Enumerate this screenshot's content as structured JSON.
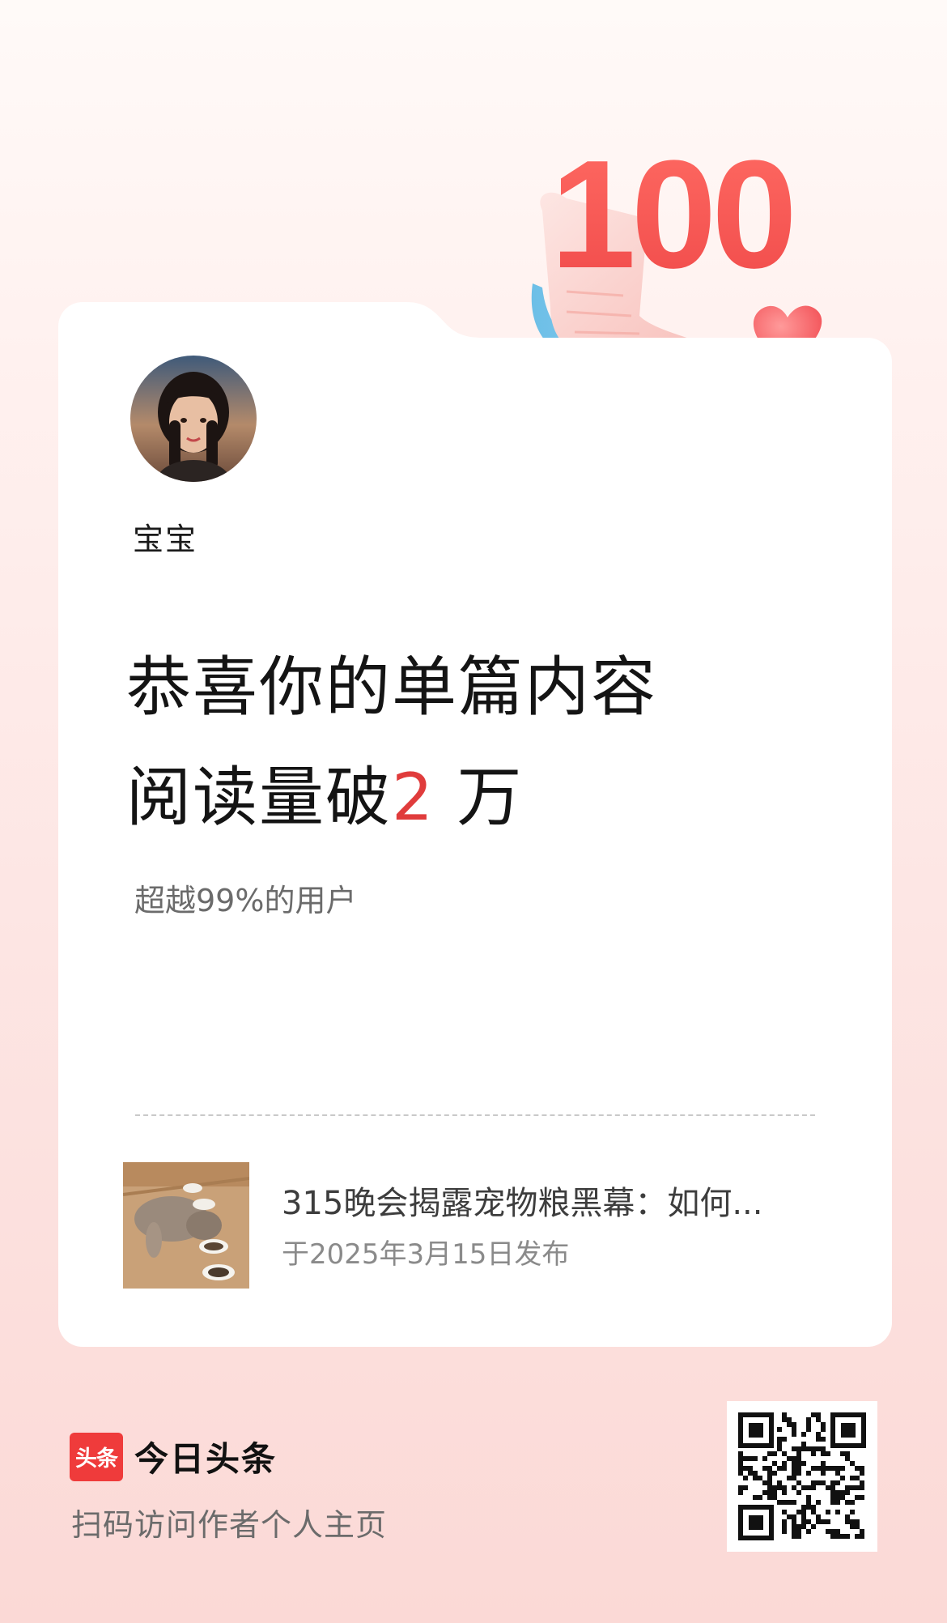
{
  "badge": {
    "number": "100"
  },
  "user": {
    "name": "宝宝"
  },
  "headline": {
    "line1": "恭喜你的单篇内容",
    "line2_prefix": "阅读量破",
    "line2_number": "2",
    "line2_suffix": " 万"
  },
  "subline": "超越99%的用户",
  "article": {
    "title": "315晚会揭露宠物粮黑幕：如何...",
    "date": "于2025年3月15日发布"
  },
  "footer": {
    "logo_text": "头条",
    "brand_name": "今日头条",
    "scan_hint": "扫码访问作者个人主页"
  },
  "colors": {
    "accent": "#e03c3c",
    "badge_red": "#f25a5a",
    "logo_red": "#ef3b3b"
  }
}
